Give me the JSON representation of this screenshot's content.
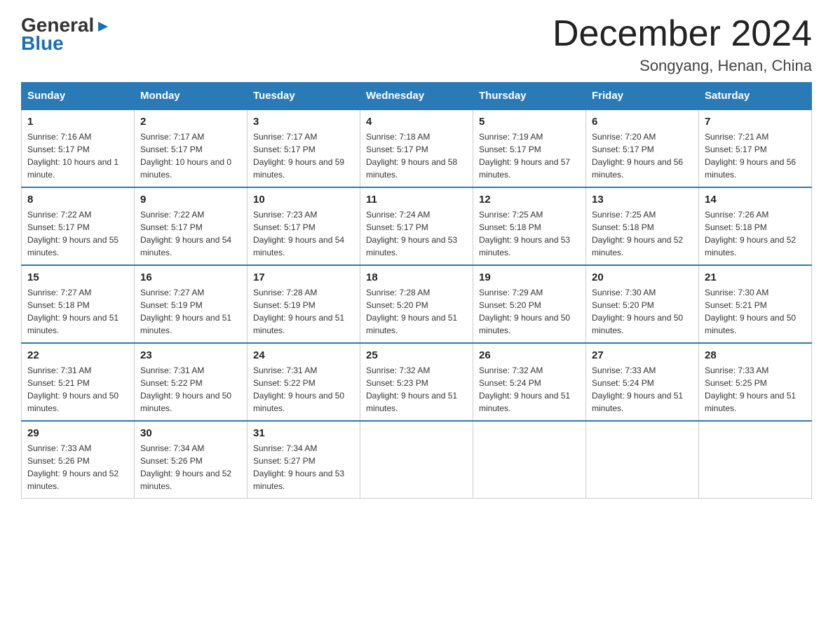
{
  "logo": {
    "general": "General",
    "blue": "Blue",
    "arrow": "▶"
  },
  "title": "December 2024",
  "location": "Songyang, Henan, China",
  "days_of_week": [
    "Sunday",
    "Monday",
    "Tuesday",
    "Wednesday",
    "Thursday",
    "Friday",
    "Saturday"
  ],
  "weeks": [
    [
      {
        "day": "1",
        "sunrise": "7:16 AM",
        "sunset": "5:17 PM",
        "daylight": "10 hours and 1 minute."
      },
      {
        "day": "2",
        "sunrise": "7:17 AM",
        "sunset": "5:17 PM",
        "daylight": "10 hours and 0 minutes."
      },
      {
        "day": "3",
        "sunrise": "7:17 AM",
        "sunset": "5:17 PM",
        "daylight": "9 hours and 59 minutes."
      },
      {
        "day": "4",
        "sunrise": "7:18 AM",
        "sunset": "5:17 PM",
        "daylight": "9 hours and 58 minutes."
      },
      {
        "day": "5",
        "sunrise": "7:19 AM",
        "sunset": "5:17 PM",
        "daylight": "9 hours and 57 minutes."
      },
      {
        "day": "6",
        "sunrise": "7:20 AM",
        "sunset": "5:17 PM",
        "daylight": "9 hours and 56 minutes."
      },
      {
        "day": "7",
        "sunrise": "7:21 AM",
        "sunset": "5:17 PM",
        "daylight": "9 hours and 56 minutes."
      }
    ],
    [
      {
        "day": "8",
        "sunrise": "7:22 AM",
        "sunset": "5:17 PM",
        "daylight": "9 hours and 55 minutes."
      },
      {
        "day": "9",
        "sunrise": "7:22 AM",
        "sunset": "5:17 PM",
        "daylight": "9 hours and 54 minutes."
      },
      {
        "day": "10",
        "sunrise": "7:23 AM",
        "sunset": "5:17 PM",
        "daylight": "9 hours and 54 minutes."
      },
      {
        "day": "11",
        "sunrise": "7:24 AM",
        "sunset": "5:17 PM",
        "daylight": "9 hours and 53 minutes."
      },
      {
        "day": "12",
        "sunrise": "7:25 AM",
        "sunset": "5:18 PM",
        "daylight": "9 hours and 53 minutes."
      },
      {
        "day": "13",
        "sunrise": "7:25 AM",
        "sunset": "5:18 PM",
        "daylight": "9 hours and 52 minutes."
      },
      {
        "day": "14",
        "sunrise": "7:26 AM",
        "sunset": "5:18 PM",
        "daylight": "9 hours and 52 minutes."
      }
    ],
    [
      {
        "day": "15",
        "sunrise": "7:27 AM",
        "sunset": "5:18 PM",
        "daylight": "9 hours and 51 minutes."
      },
      {
        "day": "16",
        "sunrise": "7:27 AM",
        "sunset": "5:19 PM",
        "daylight": "9 hours and 51 minutes."
      },
      {
        "day": "17",
        "sunrise": "7:28 AM",
        "sunset": "5:19 PM",
        "daylight": "9 hours and 51 minutes."
      },
      {
        "day": "18",
        "sunrise": "7:28 AM",
        "sunset": "5:20 PM",
        "daylight": "9 hours and 51 minutes."
      },
      {
        "day": "19",
        "sunrise": "7:29 AM",
        "sunset": "5:20 PM",
        "daylight": "9 hours and 50 minutes."
      },
      {
        "day": "20",
        "sunrise": "7:30 AM",
        "sunset": "5:20 PM",
        "daylight": "9 hours and 50 minutes."
      },
      {
        "day": "21",
        "sunrise": "7:30 AM",
        "sunset": "5:21 PM",
        "daylight": "9 hours and 50 minutes."
      }
    ],
    [
      {
        "day": "22",
        "sunrise": "7:31 AM",
        "sunset": "5:21 PM",
        "daylight": "9 hours and 50 minutes."
      },
      {
        "day": "23",
        "sunrise": "7:31 AM",
        "sunset": "5:22 PM",
        "daylight": "9 hours and 50 minutes."
      },
      {
        "day": "24",
        "sunrise": "7:31 AM",
        "sunset": "5:22 PM",
        "daylight": "9 hours and 50 minutes."
      },
      {
        "day": "25",
        "sunrise": "7:32 AM",
        "sunset": "5:23 PM",
        "daylight": "9 hours and 51 minutes."
      },
      {
        "day": "26",
        "sunrise": "7:32 AM",
        "sunset": "5:24 PM",
        "daylight": "9 hours and 51 minutes."
      },
      {
        "day": "27",
        "sunrise": "7:33 AM",
        "sunset": "5:24 PM",
        "daylight": "9 hours and 51 minutes."
      },
      {
        "day": "28",
        "sunrise": "7:33 AM",
        "sunset": "5:25 PM",
        "daylight": "9 hours and 51 minutes."
      }
    ],
    [
      {
        "day": "29",
        "sunrise": "7:33 AM",
        "sunset": "5:26 PM",
        "daylight": "9 hours and 52 minutes."
      },
      {
        "day": "30",
        "sunrise": "7:34 AM",
        "sunset": "5:26 PM",
        "daylight": "9 hours and 52 minutes."
      },
      {
        "day": "31",
        "sunrise": "7:34 AM",
        "sunset": "5:27 PM",
        "daylight": "9 hours and 53 minutes."
      },
      null,
      null,
      null,
      null
    ]
  ]
}
